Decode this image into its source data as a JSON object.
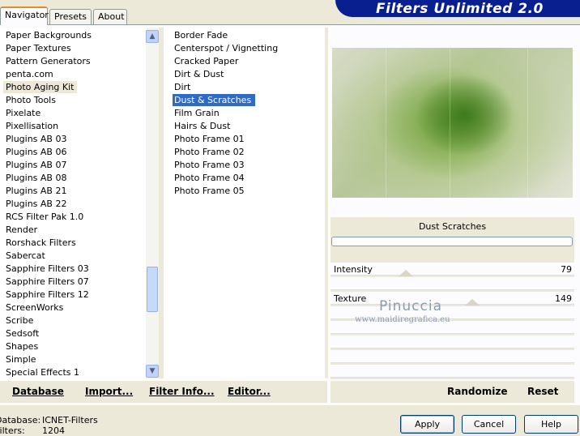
{
  "tabs": [
    "Navigator",
    "Presets",
    "About"
  ],
  "app_title": "Filters Unlimited 2.0",
  "categories": [
    "Paper Backgrounds",
    "Paper Textures",
    "Pattern Generators",
    "penta.com",
    "Photo Aging Kit",
    "Photo Tools",
    "Pixelate",
    "Pixellisation",
    "Plugins AB 03",
    "Plugins AB 06",
    "Plugins AB 07",
    "Plugins AB 08",
    "Plugins AB 21",
    "Plugins AB 22",
    "RCS Filter Pak 1.0",
    "Render",
    "Rorshack Filters",
    "Sabercat",
    "Sapphire Filters 03",
    "Sapphire Filters 07",
    "Sapphire Filters 12",
    "ScreenWorks",
    "Scribe",
    "Sedsoft",
    "Shapes",
    "Simple",
    "Special Effects 1"
  ],
  "selected_category": "Photo Aging Kit",
  "filters": [
    "Border Fade",
    "Centerspot / Vignetting",
    "Cracked Paper",
    "Dirt & Dust",
    "Dirt",
    "Dust & Scratches",
    "Film Grain",
    "Hairs & Dust",
    "Photo Frame 01",
    "Photo Frame 02",
    "Photo Frame 03",
    "Photo Frame 04",
    "Photo Frame 05"
  ],
  "selected_filter": "Dust & Scratches",
  "filter_display_name": "Dust  Scratches",
  "progress": 0,
  "controls": [
    {
      "label": "Intensity",
      "value": "79"
    },
    {
      "label": "Texture",
      "value": "149"
    }
  ],
  "watermark": {
    "name": "Pinuccia",
    "url": "www.maidiregrafica.eu"
  },
  "left_links": {
    "database": "Database",
    "import": "Import...",
    "filter_info": "Filter Info...",
    "editor": "Editor..."
  },
  "right_links": {
    "randomize": "Randomize",
    "reset": "Reset"
  },
  "status": {
    "database_label": "Database:",
    "database_value": "ICNET-Filters",
    "filters_label": "Filters:",
    "filters_value": "1204"
  },
  "buttons": {
    "apply": "Apply",
    "cancel": "Cancel",
    "help": "Help"
  },
  "colors": {
    "banner": "#0a1f8f",
    "selection": "#316ac5",
    "active_tab_accent": "#e68b2c"
  }
}
